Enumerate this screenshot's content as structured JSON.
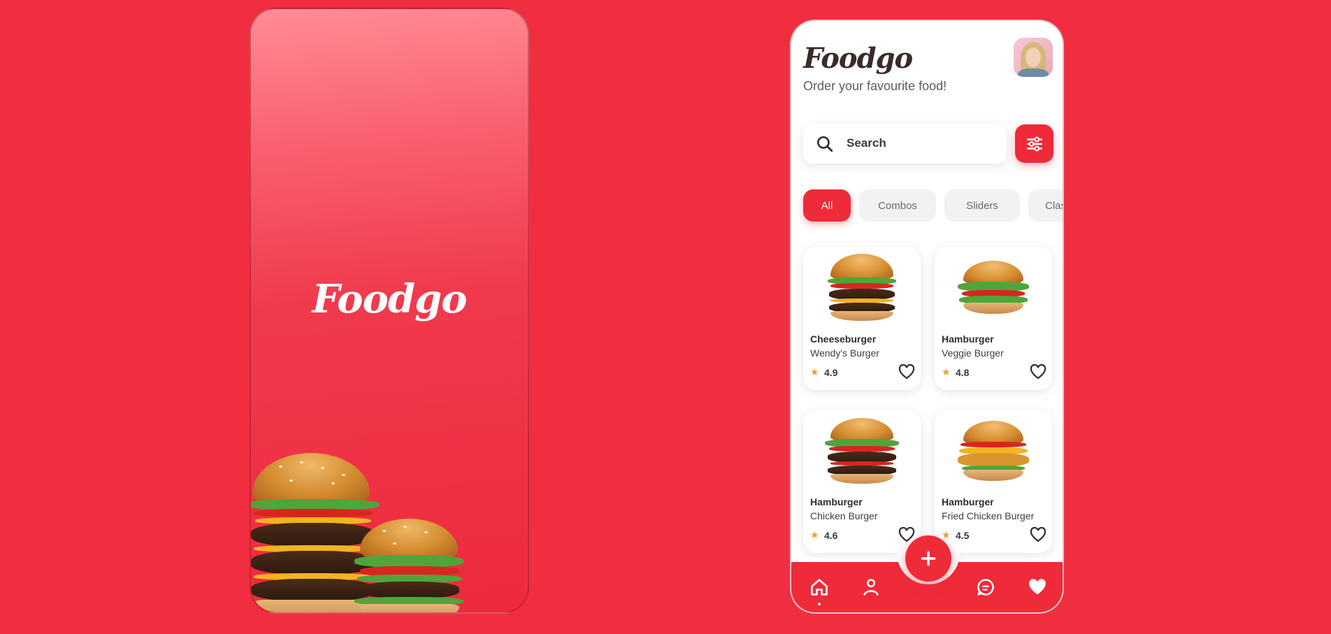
{
  "splash": {
    "logo": "Foodgo"
  },
  "home": {
    "brand": "Foodgo",
    "tagline": "Order your favourite food!",
    "search": {
      "placeholder": "Search",
      "icon": "search-icon"
    },
    "filter_icon": "sliders-icon",
    "categories": [
      {
        "label": "All",
        "active": true
      },
      {
        "label": "Combos",
        "active": false
      },
      {
        "label": "Sliders",
        "active": false
      },
      {
        "label": "Clas",
        "active": false
      }
    ],
    "products": [
      {
        "type": "Cheeseburger",
        "name": "Wendy's Burger",
        "rating": "4.9"
      },
      {
        "type": "Hamburger",
        "name": "Veggie Burger",
        "rating": "4.8"
      },
      {
        "type": "Hamburger",
        "name": "Chicken Burger",
        "rating": "4.6"
      },
      {
        "type": "Hamburger",
        "name": "Fried Chicken Burger",
        "rating": "4.5"
      }
    ],
    "star_glyph": "★",
    "nav": [
      {
        "icon": "home-icon",
        "active": true
      },
      {
        "icon": "profile-icon",
        "active": false
      },
      {
        "icon": "add-icon",
        "active": false
      },
      {
        "icon": "chat-icon",
        "active": false
      },
      {
        "icon": "heart-icon",
        "active": false
      }
    ]
  },
  "colors": {
    "background": "#F02E40",
    "accent": "#EF2A39",
    "star": "#F29B28",
    "brand_text": "#3B2A2A"
  }
}
